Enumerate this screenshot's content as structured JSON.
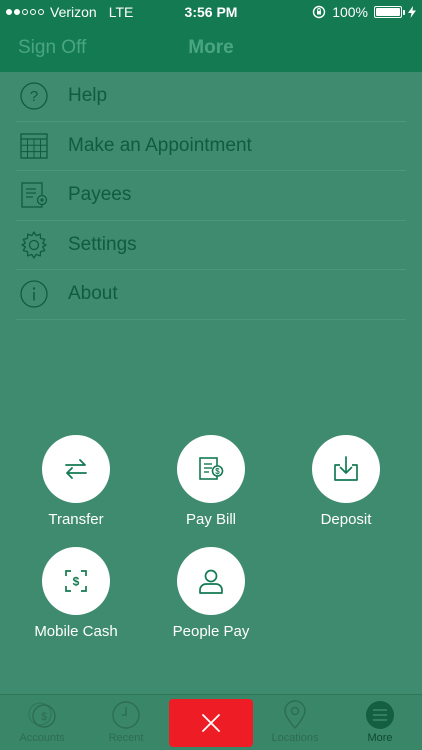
{
  "status_bar": {
    "carrier": "Verizon",
    "network": "LTE",
    "time": "3:56 PM",
    "battery": "100%",
    "battery_level": 1.0
  },
  "nav": {
    "left_label": "Sign Off",
    "title": "More"
  },
  "menu": {
    "items": [
      {
        "label": "Help",
        "icon": "question-icon"
      },
      {
        "label": "Make an Appointment",
        "icon": "calendar-icon"
      },
      {
        "label": "Payees",
        "icon": "payees-icon"
      },
      {
        "label": "Settings",
        "icon": "gear-icon"
      },
      {
        "label": "About",
        "icon": "info-icon"
      }
    ]
  },
  "actions": [
    {
      "label": "Transfer",
      "icon": "transfer-icon"
    },
    {
      "label": "Pay Bill",
      "icon": "pay-bill-icon"
    },
    {
      "label": "Deposit",
      "icon": "deposit-icon"
    },
    {
      "label": "Mobile Cash",
      "icon": "mobile-cash-icon"
    },
    {
      "label": "People Pay",
      "icon": "person-icon"
    }
  ],
  "tabs": [
    {
      "label": "Accounts",
      "icon": "accounts-icon"
    },
    {
      "label": "Recent",
      "icon": "clock-icon"
    },
    {
      "label": "",
      "icon": "close-icon"
    },
    {
      "label": "Locations",
      "icon": "location-pin-icon"
    },
    {
      "label": "More",
      "icon": "menu-icon"
    }
  ],
  "colors": {
    "header": "#137a52",
    "background": "#3f8b6f",
    "close_button": "#ee1c25",
    "icon_green": "#137a52"
  }
}
